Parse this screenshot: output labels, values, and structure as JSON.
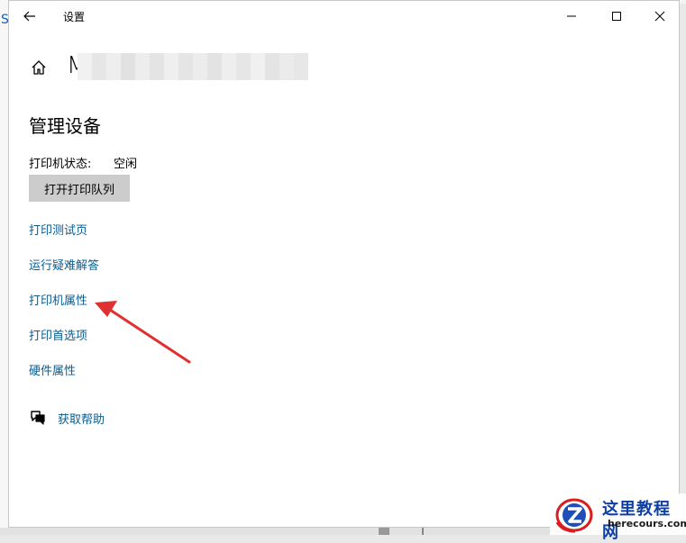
{
  "window": {
    "title": "设置",
    "back_icon": "arrow-left-icon",
    "controls": [
      "minimize-icon",
      "maximize-icon",
      "close-icon"
    ]
  },
  "header": {
    "home_icon": "home-icon",
    "device_name": "M"
  },
  "section": {
    "title": "管理设备",
    "status_label": "打印机状态:",
    "status_value": "空闲",
    "open_queue_label": "打开打印队列"
  },
  "links": [
    "打印测试页",
    "运行疑难解答",
    "打印机属性",
    "打印首选项",
    "硬件属性"
  ],
  "help": {
    "icon": "chat-bubble-icon",
    "label": "获取帮助"
  },
  "annotation": {
    "color": "#e03030",
    "points_to": "打印机属性"
  },
  "watermark": {
    "line1": "这里教程网",
    "line2": "herecours.com"
  },
  "colors": {
    "link": "#0a5c8f",
    "button_bg": "#cccccc",
    "window_bg": "#ffffff"
  },
  "desktop": {
    "left_glyph": "S"
  }
}
